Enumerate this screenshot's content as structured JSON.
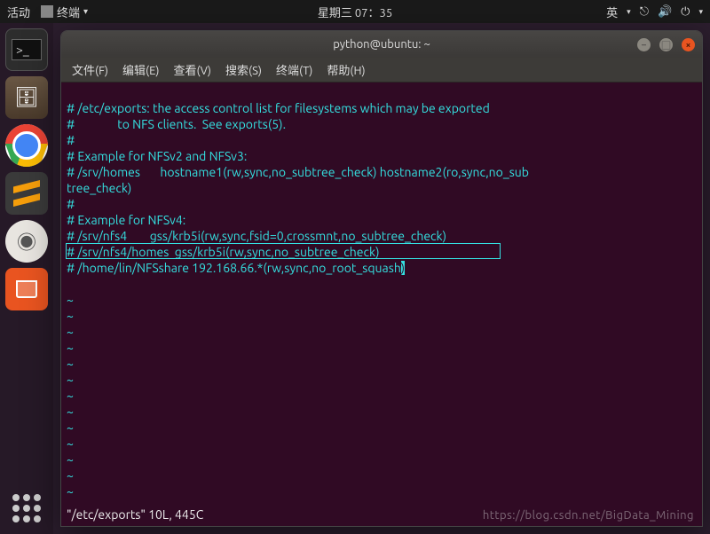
{
  "top_panel": {
    "activities": "活动",
    "app_label": "终端",
    "clock": "星期三 07：35",
    "input_method": "英",
    "network_icon": "network-icon",
    "volume_icon": "volume-icon",
    "power_icon": "power-icon"
  },
  "launcher": {
    "items": [
      "terminal",
      "files",
      "chrome",
      "sublime",
      "rhythmbox",
      "software"
    ],
    "apps_button": "show-applications"
  },
  "window": {
    "title": "python@ubuntu: ~",
    "menus": {
      "file": "文件(F)",
      "edit": "编辑(E)",
      "view": "查看(V)",
      "search": "搜索(S)",
      "terminal": "终端(T)",
      "help": "帮助(H)"
    }
  },
  "editor": {
    "lines": [
      "# /etc/exports: the access control list for filesystems which may be exported",
      "#               to NFS clients.  See exports(5).",
      "#",
      "# Example for NFSv2 and NFSv3:",
      "# /srv/homes       hostname1(rw,sync,no_subtree_check) hostname2(ro,sync,no_sub",
      "tree_check)",
      "#",
      "# Example for NFSv4:",
      "# /srv/nfs4        gss/krb5i(rw,sync,fsid=0,crossmnt,no_subtree_check)",
      "# /srv/nfs4/homes  gss/krb5i(rw,sync,no_subtree_check)",
      "# /home/lin/NFSshare 192.168.66.*(rw,sync,no_root_squash"
    ],
    "cursor_char": ")",
    "status_line": "\"/etc/exports\" 10L, 445C"
  },
  "watermark": "https://blog.csdn.net/BigData_Mining"
}
